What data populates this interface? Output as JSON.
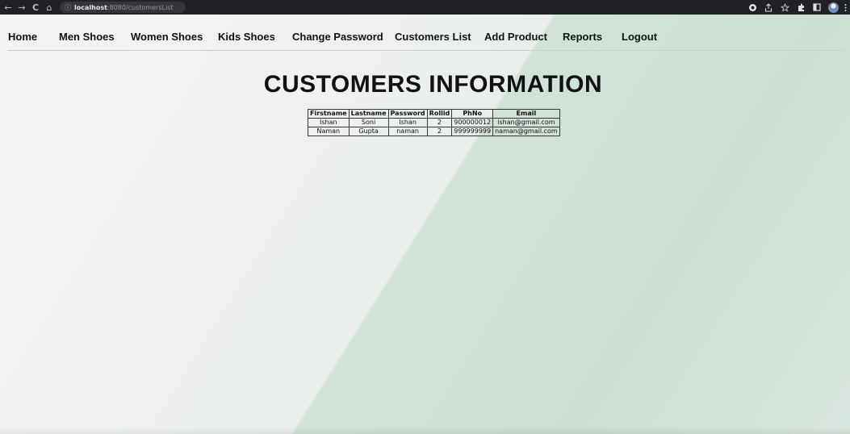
{
  "browser": {
    "back_icon": "←",
    "forward_icon": "→",
    "reload_icon": "C",
    "home_icon": "⌂",
    "info_icon": "ⓘ",
    "url_host": "localhost",
    "url_path": ":8080/customersList"
  },
  "nav": {
    "items": [
      {
        "label": "Home"
      },
      {
        "label": "Men Shoes"
      },
      {
        "label": "Women Shoes"
      },
      {
        "label": "Kids Shoes"
      },
      {
        "label": "Change Password"
      },
      {
        "label": "Customers List"
      },
      {
        "label": "Add Product"
      },
      {
        "label": "Reports"
      },
      {
        "label": "Logout"
      }
    ]
  },
  "page": {
    "title": "CUSTOMERS INFORMATION"
  },
  "table": {
    "headers": [
      "Firstname",
      "Lastname",
      "Password",
      "Rollid",
      "PhNo",
      "Email"
    ],
    "rows": [
      [
        "Ishan",
        "Soni",
        "Ishan",
        "2",
        "900000012",
        "ishan@gmail.com"
      ],
      [
        "Naman",
        "Gupta",
        "naman",
        "2",
        "999999999",
        "naman@gmail.com"
      ]
    ]
  }
}
